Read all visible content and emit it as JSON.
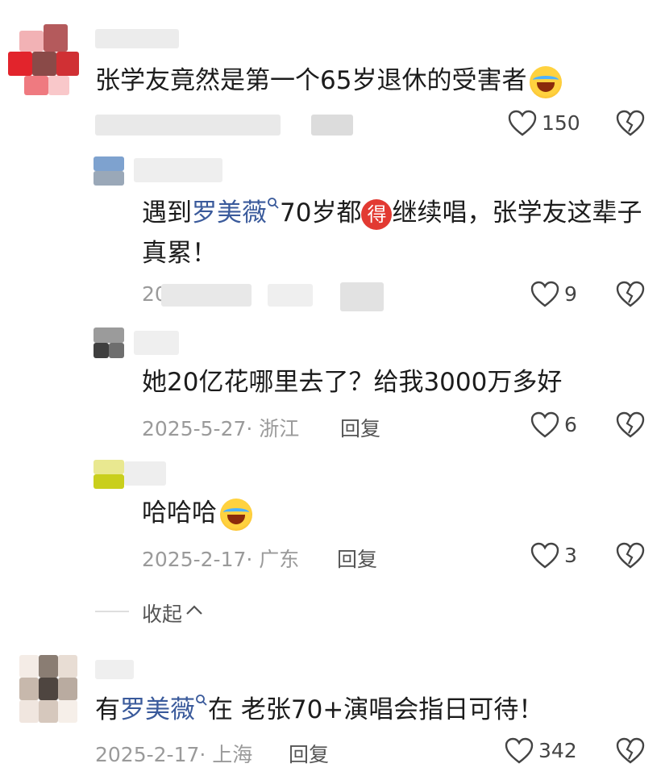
{
  "comments": [
    {
      "text": "张学友竟然是第一个65岁退休的受害者",
      "likes": "150"
    },
    {
      "text_a": "遇到",
      "mention": "罗美薇",
      "text_b": "70岁都",
      "badge": "得",
      "text_c": "继续唱，张学友这辈子",
      "text_line2": "真累！",
      "meta_partial": "20",
      "likes": "9"
    },
    {
      "text": "她20亿花哪里去了？给我3000万多好",
      "meta": "2025-5-27· 浙江",
      "reply": "回复",
      "likes": "6"
    },
    {
      "text": "哈哈哈",
      "meta": "2025-2-17· 广东",
      "reply": "回复",
      "likes": "3"
    },
    {
      "text_a": "有",
      "mention": "罗美薇",
      "text_b": "在 老张70+演唱会指日可待！",
      "meta": "2025-2-17· 上海",
      "reply": "回复",
      "likes": "342"
    }
  ],
  "collapse": "收起",
  "icons": {
    "like": "heart-outline-icon",
    "dislike": "broken-heart-icon",
    "search": "search-icon",
    "chevron": "chevron-up-icon",
    "emoji": "laughing-crying-emoji-icon"
  },
  "colors": {
    "mention": "#3a5a9b",
    "meta": "#9a9a9a",
    "badge": "#e23a32"
  }
}
